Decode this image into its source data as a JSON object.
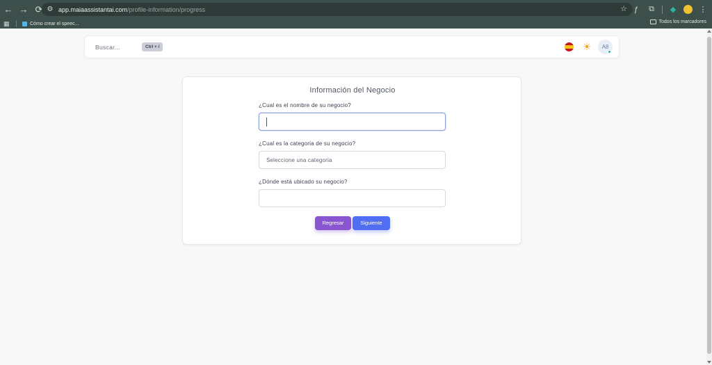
{
  "browser": {
    "url_domain": "app.maiaassistantai.com",
    "url_path": "/profile-information/progress",
    "bookmark_label": "Cómo crear el speec...",
    "all_bookmarks_label": "Todos los marcadores"
  },
  "header": {
    "search_label": "Buscar...",
    "shortcut": "Ctrl + /",
    "avatar_initials": "A8"
  },
  "form": {
    "title": "Información del Negocio",
    "q_name": "¿Cual es el nombre de su negocio?",
    "name_value": "",
    "q_category": "¿Cual es la categoria de su negocio?",
    "category_selected": "Seleccione una categoria",
    "q_location": "¿Dónde está ubicado su negocio?",
    "location_value": "",
    "back_label": "Regresar",
    "next_label": "Siguiente"
  },
  "colors": {
    "chrome": "#3d4f4b",
    "back_button": "#8a55d0",
    "next_button": "#4f6ef2",
    "status_dot": "#14b8a6"
  }
}
